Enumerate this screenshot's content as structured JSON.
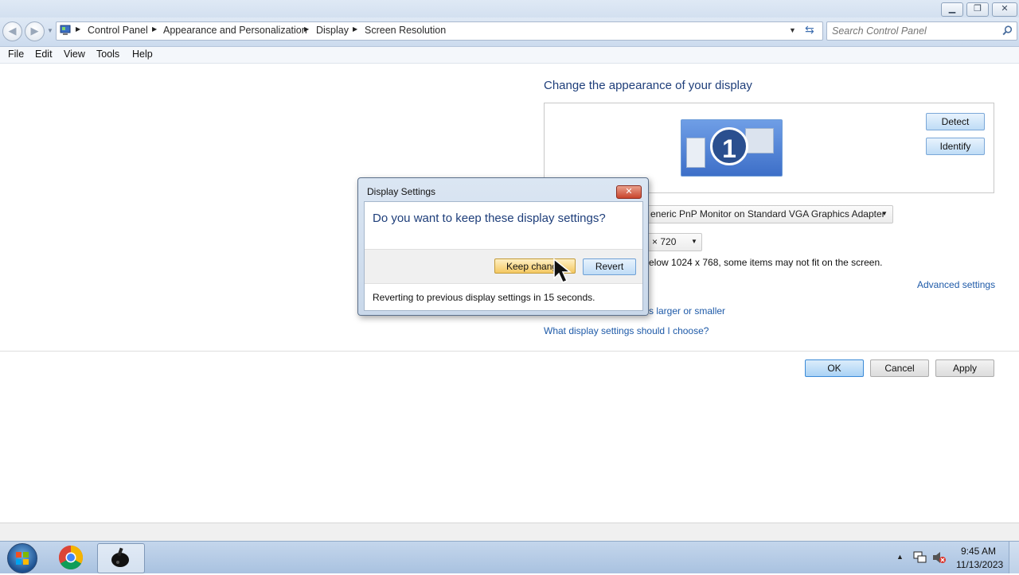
{
  "window": {
    "buttons": {
      "minimize_icon": "minimize-icon",
      "restore_icon": "restore-icon",
      "close_icon": "close-icon"
    }
  },
  "address": {
    "breadcrumbs": [
      "Control Panel",
      "Appearance and Personalization",
      "Display",
      "Screen Resolution"
    ],
    "search_placeholder": "Search Control Panel"
  },
  "menu": [
    "File",
    "Edit",
    "View",
    "Tools",
    "Help"
  ],
  "main": {
    "heading": "Change the appearance of your display",
    "monitor_number": "1",
    "detect_label": "Detect",
    "identify_label": "Identify",
    "display_value": "eneric PnP Monitor on Standard VGA Graphics Adapter",
    "resolution_value": "× 720",
    "warning_text": "elow 1024 x 768, some items may not fit on the screen.",
    "advanced_link": "Advanced settings",
    "text_size_link": "s larger or smaller",
    "help_link": "What display settings should I choose?",
    "ok_label": "OK",
    "cancel_label": "Cancel",
    "apply_label": "Apply"
  },
  "dialog": {
    "title": "Display Settings",
    "question": "Do you want to keep these display settings?",
    "keep_label": "Keep chang",
    "revert_label": "Revert",
    "countdown": "Reverting to previous display settings in 15 seconds."
  },
  "taskbar": {
    "time": "9:45 AM",
    "date": "11/13/2023"
  },
  "colors": {
    "accent_text": "#1e3e7a",
    "link": "#1e5aa8",
    "taskbar": "#b7cce6"
  }
}
